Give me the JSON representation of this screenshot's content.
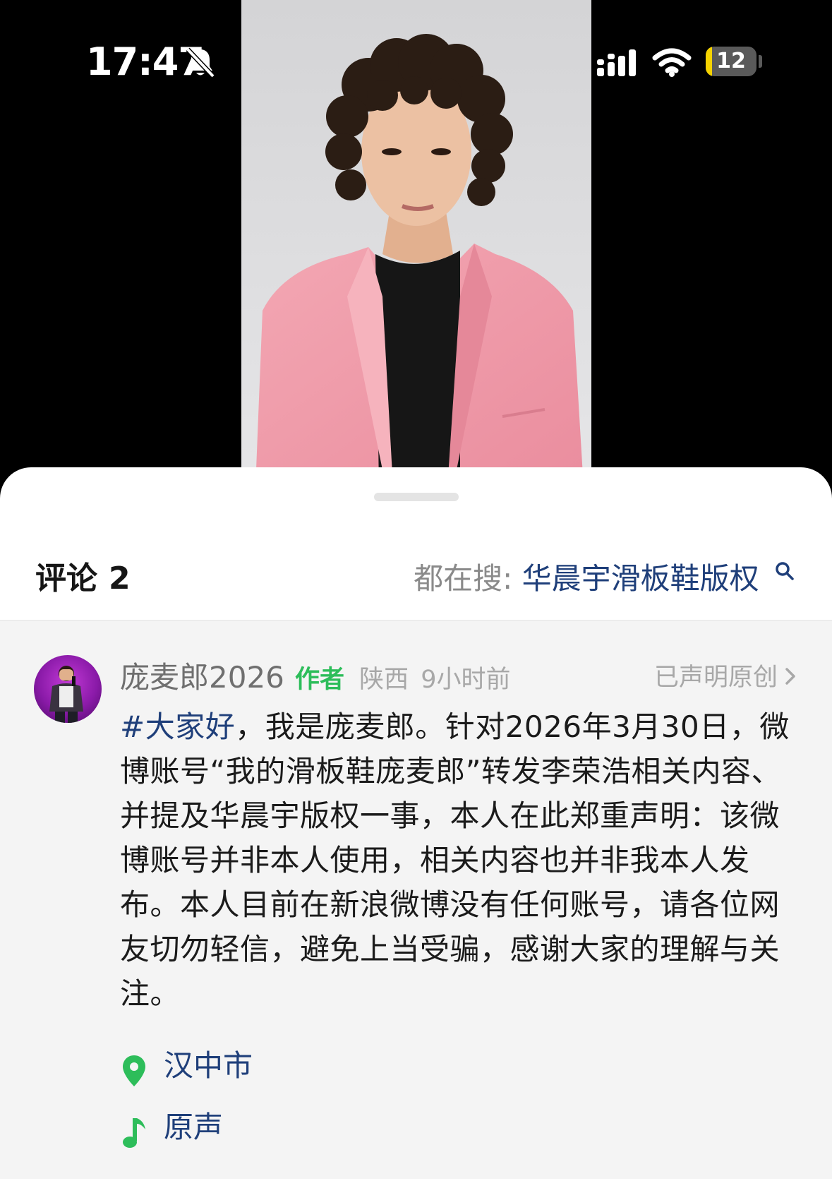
{
  "status_bar": {
    "time": "17:47",
    "battery_level": "12",
    "battery_fraction": 0.12,
    "icons": [
      "bell-slash-icon",
      "signal-icon",
      "wifi-icon",
      "battery-icon"
    ]
  },
  "video": {
    "description_icons": [
      "video-frame"
    ]
  },
  "sheet": {
    "comments_label": "评论",
    "comments_count": "2",
    "trending_prefix": "都在搜:",
    "trending_query": "华晨宇滑板鞋版权",
    "search_icon": "search-icon"
  },
  "comment": {
    "author": "庞麦郎2026",
    "badge": "作者",
    "location": "陕西",
    "time": "9小时前",
    "original_claim": "已声明原创",
    "hashtag": "#大家好",
    "text": "，我是庞麦郎。针对2026年3月30日，微博账号“我的滑板鞋庞麦郎”转发李荣浩相关内容、并提及华晨宇版权一事，本人在此郑重声明：该微博账号并非本人使用，相关内容也并非我本人发布。本人目前在新浪微博没有任何账号，请各位网友切勿轻信，避免上当受骗，感谢大家的理解与关注。",
    "location_tag": "汉中市",
    "audio_tag": "原声"
  },
  "colors": {
    "link_blue": "#1f3f7a",
    "author_green": "#2dbd5a",
    "tag_green": "#2dbd5a",
    "comment_bg": "#f4f4f4",
    "battery_yellow": "#f5d300",
    "jacket_pink": "#f09aa8"
  }
}
